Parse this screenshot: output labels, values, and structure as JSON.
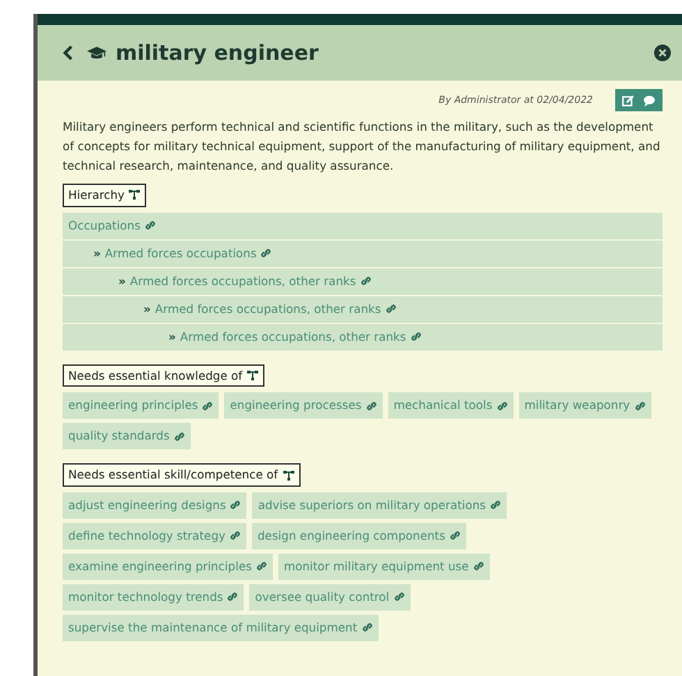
{
  "dialog": {
    "title": "military engineer",
    "byline": "By Administrator at 02/04/2022",
    "description": "Military engineers perform technical and scientific functions in the military, such as the development of concepts for military technical equipment, support of the manufacturing of military equipment, and technical research, maintenance, and quality assurance."
  },
  "hierarchy": {
    "label": "Hierarchy",
    "items": [
      {
        "label": "Occupations",
        "children": [
          {
            "prefix": "»",
            "label": "Armed forces occupations",
            "children": [
              {
                "prefix": "»",
                "label": "Armed forces occupations, other ranks",
                "children": [
                  {
                    "prefix": "»",
                    "label": "Armed forces occupations, other ranks",
                    "children": [
                      {
                        "prefix": "»",
                        "label": "Armed forces occupations, other ranks"
                      }
                    ]
                  }
                ]
              }
            ]
          }
        ]
      }
    ]
  },
  "knowledge": {
    "label": "Needs essential knowledge of",
    "rows": [
      [
        "engineering principles",
        "engineering processes",
        "mechanical tools",
        "military weaponry"
      ],
      [
        "quality standards"
      ]
    ]
  },
  "skills": {
    "label": "Needs essential skill/competence of",
    "rows": [
      [
        "adjust engineering designs",
        "advise superiors on military operations"
      ],
      [
        "define technology strategy",
        "design engineering components"
      ],
      [
        "examine engineering principles",
        "monitor military equipment use"
      ],
      [
        "monitor technology trends",
        "oversee quality control"
      ],
      [
        "supervise the maintenance of military equipment"
      ]
    ]
  }
}
